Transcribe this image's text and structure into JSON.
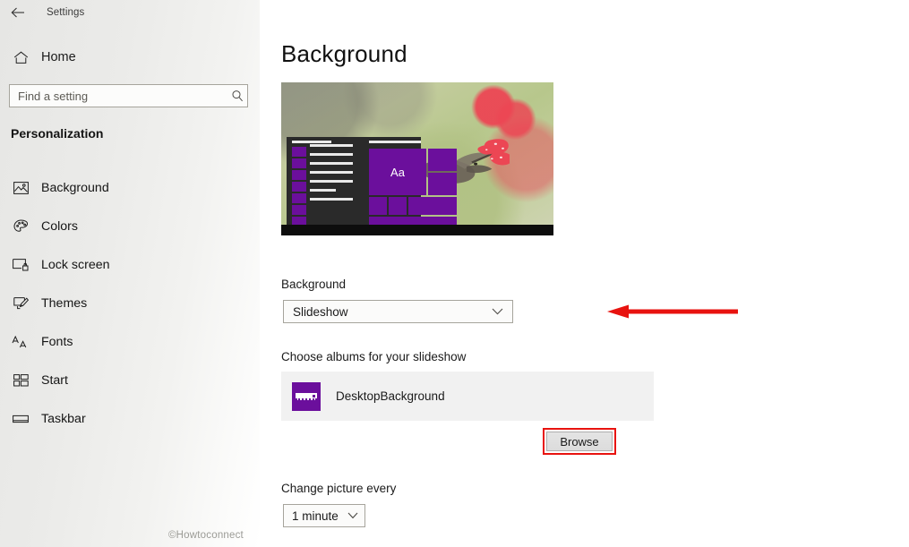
{
  "window": {
    "app_title": "Settings",
    "back_icon": "back-arrow-icon"
  },
  "sidebar": {
    "home": {
      "label": "Home",
      "icon": "home-icon"
    },
    "search": {
      "placeholder": "Find a setting",
      "value": "",
      "icon": "search-icon"
    },
    "section_title": "Personalization",
    "items": [
      {
        "label": "Background",
        "icon": "picture-icon"
      },
      {
        "label": "Colors",
        "icon": "palette-icon"
      },
      {
        "label": "Lock screen",
        "icon": "lock-screen-icon"
      },
      {
        "label": "Themes",
        "icon": "themes-brush-icon"
      },
      {
        "label": "Fonts",
        "icon": "fonts-aa-icon"
      },
      {
        "label": "Start",
        "icon": "start-tiles-icon"
      },
      {
        "label": "Taskbar",
        "icon": "taskbar-icon"
      }
    ]
  },
  "main": {
    "page_title": "Background",
    "preview": {
      "description": "Desktop preview showing hummingbird and red flowers wallpaper with Start menu overlay",
      "start_tile_text": "Aa",
      "accent_color": "#6b0f9c"
    },
    "background_field": {
      "label": "Background",
      "value": "Slideshow",
      "chevron_icon": "chevron-down-icon"
    },
    "albums_field": {
      "label": "Choose albums for your slideshow",
      "album_name": "DesktopBackground",
      "album_icon": "folder-picture-icon",
      "browse_label": "Browse"
    },
    "interval_field": {
      "label": "Change picture every",
      "value": "1 minute",
      "chevron_icon": "chevron-down-icon"
    }
  },
  "annotations": {
    "arrow_color": "#e8130f",
    "highlight_color": "#e8130f"
  },
  "watermark": "©Howtoconnect"
}
